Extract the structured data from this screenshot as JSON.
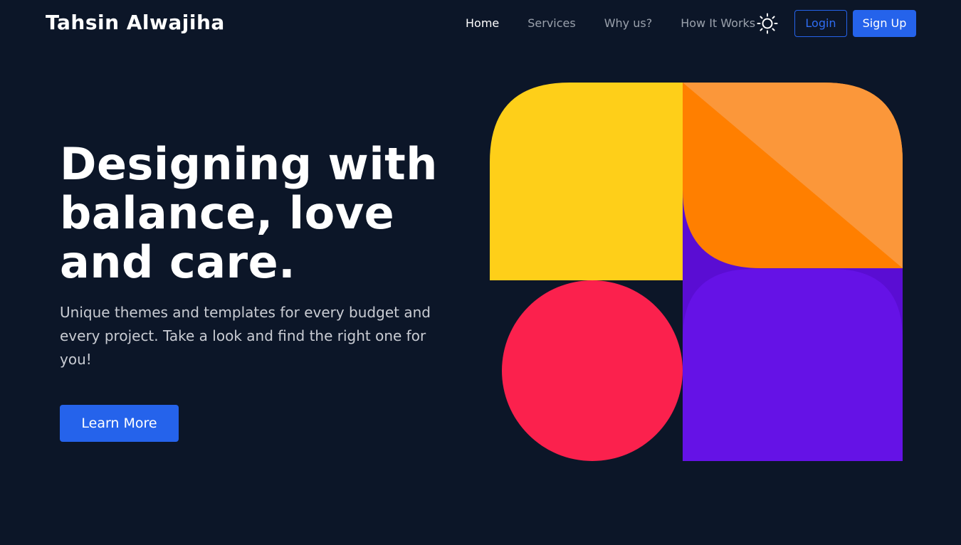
{
  "brand": {
    "name": "Tahsin Alwajiha"
  },
  "nav": {
    "items": [
      "Home",
      "Services",
      "Why us?",
      "How It Works"
    ],
    "active": "Home",
    "theme_toggle_icon": "sun-icon"
  },
  "auth": {
    "login_label": "Login",
    "signup_label": "Sign Up"
  },
  "hero": {
    "title": "Designing with balance, love and care.",
    "subtitle": "Unique themes and templates for every budget and every project. Take a look and find the right one for you!",
    "cta_label": "Learn More"
  },
  "colors": {
    "background": "#0c1628",
    "accent": "#2563eb",
    "yellow": "#fecf19",
    "orange": "#ff7f00",
    "orange_light": "#fb973a",
    "red": "#fb214d",
    "purple": "#6512e6",
    "purple_dark": "#5a0dd3"
  }
}
